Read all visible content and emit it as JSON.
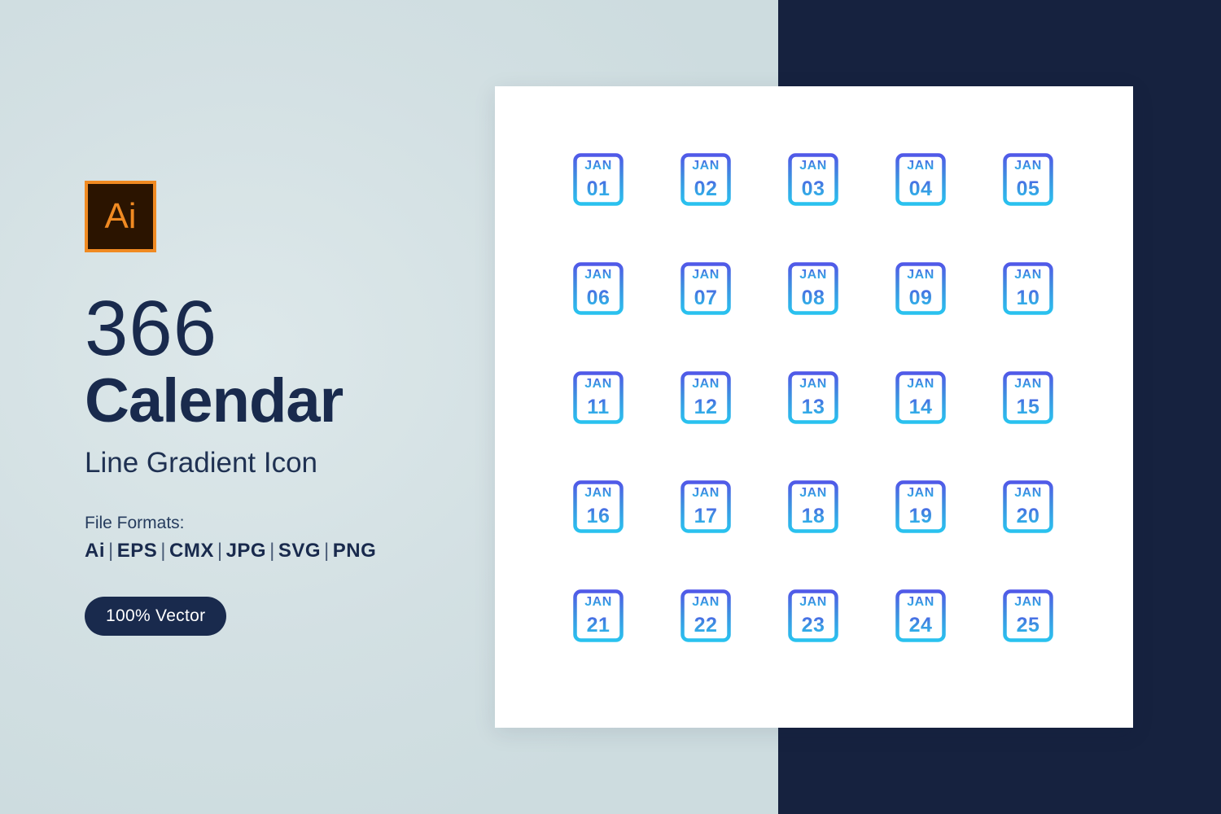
{
  "colors": {
    "bg_light": "#d3e0e3",
    "bg_dark": "#16223f",
    "card": "#ffffff",
    "navy_text": "#192a4d",
    "ai_orange": "#f08a22",
    "ai_dark": "#2b1400",
    "icon_gradient_top": "#5159e8",
    "icon_gradient_mid": "#3d8fe0",
    "icon_gradient_bottom": "#29c2ef"
  },
  "info": {
    "ai_badge_label": "Ai",
    "count": "366",
    "title": "Calendar",
    "subtitle": "Line Gradient Icon",
    "formats_label": "File Formats:",
    "formats": [
      "Ai",
      "EPS",
      "CMX",
      "JPG",
      "SVG",
      "PNG"
    ],
    "format_separator": "|",
    "vector_badge": "100% Vector"
  },
  "icons": {
    "month_label": "JAN",
    "rows": [
      [
        "01",
        "02",
        "03",
        "04",
        "05"
      ],
      [
        "06",
        "07",
        "08",
        "09",
        "10"
      ],
      [
        "11",
        "12",
        "13",
        "14",
        "15"
      ],
      [
        "16",
        "17",
        "18",
        "19",
        "20"
      ],
      [
        "21",
        "22",
        "23",
        "24",
        "25"
      ]
    ],
    "days": [
      "01",
      "02",
      "03",
      "04",
      "05",
      "06",
      "07",
      "08",
      "09",
      "10",
      "11",
      "12",
      "13",
      "14",
      "15",
      "16",
      "17",
      "18",
      "19",
      "20",
      "21",
      "22",
      "23",
      "24",
      "25"
    ]
  }
}
